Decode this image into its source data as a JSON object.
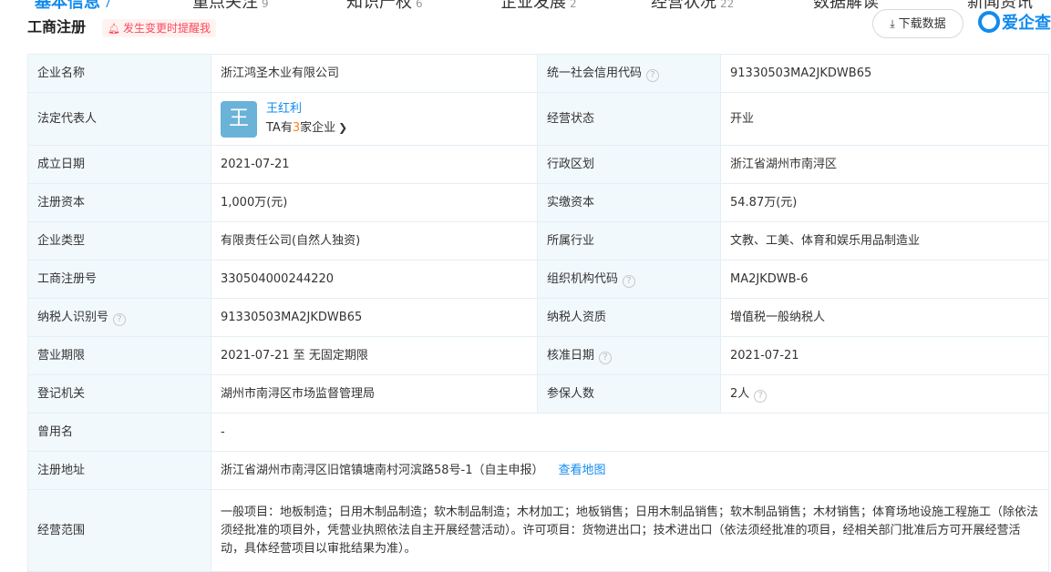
{
  "tabs": [
    {
      "label": "基本信息",
      "count": "7",
      "active": true
    },
    {
      "label": "重点关注",
      "count": "9"
    },
    {
      "label": "知识产权",
      "count": "6"
    },
    {
      "label": "企业发展",
      "count": "2"
    },
    {
      "label": "经营状况",
      "count": "22"
    },
    {
      "label": "数据解读",
      "count": ""
    },
    {
      "label": "新闻资讯",
      "count": ""
    }
  ],
  "header": {
    "title": "工商注册",
    "remind": "发生变更时提醒我",
    "download": "下载数据",
    "brand": "爱企查"
  },
  "rows": {
    "r1": {
      "l1": "企业名称",
      "v1": "浙江鸿圣木业有限公司",
      "l2": "统一社会信用代码",
      "v2": "91330503MA2JKDWB65"
    },
    "r2": {
      "l1": "法定代表人",
      "avatar": "王",
      "name": "王红利",
      "sub_pre": "TA有",
      "sub_count": "3",
      "sub_post": "家企业",
      "l2": "经营状态",
      "v2": "开业"
    },
    "r3": {
      "l1": "成立日期",
      "v1": "2021-07-21",
      "l2": "行政区划",
      "v2": "浙江省湖州市南浔区"
    },
    "r4": {
      "l1": "注册资本",
      "v1": "1,000万(元)",
      "l2": "实缴资本",
      "v2": "54.87万(元)"
    },
    "r5": {
      "l1": "企业类型",
      "v1": "有限责任公司(自然人独资)",
      "l2": "所属行业",
      "v2": "文教、工美、体育和娱乐用品制造业"
    },
    "r6": {
      "l1": "工商注册号",
      "v1": "330504000244220",
      "l2": "组织机构代码",
      "v2": "MA2JKDWB-6"
    },
    "r7": {
      "l1": "纳税人识别号",
      "v1": "91330503MA2JKDWB65",
      "l2": "纳税人资质",
      "v2": "增值税一般纳税人"
    },
    "r8": {
      "l1": "营业期限",
      "v1": "2021-07-21 至 无固定期限",
      "l2": "核准日期",
      "v2": "2021-07-21"
    },
    "r9": {
      "l1": "登记机关",
      "v1": "湖州市南浔区市场监督管理局",
      "l2": "参保人数",
      "v2": "2人"
    },
    "r10": {
      "l1": "曾用名",
      "v1": "-"
    },
    "r11": {
      "l1": "注册地址",
      "v1": "浙江省湖州市南浔区旧馆镇塘南村河滨路58号-1（自主申报）",
      "link": "查看地图"
    },
    "r12": {
      "l1": "经营范围",
      "v1": "一般项目：地板制造；日用木制品制造；软木制品制造；木材加工；地板销售；日用木制品销售；软木制品销售；木材销售；体育场地设施工程施工（除依法须经批准的项目外，凭营业执照依法自主开展经营活动）。许可项目：货物进出口；技术进出口（依法须经批准的项目，经相关部门批准后方可开展经营活动，具体经营项目以审批结果为准）。"
    }
  },
  "icons": {
    "help": "question-icon",
    "bell": "bell-icon",
    "download": "download-icon",
    "chevron": "chevron-right-icon"
  },
  "colors": {
    "accent": "#128bed",
    "label_bg": "#f2f9fc",
    "border": "#e4eef6",
    "alert": "#fd485e",
    "highlight": "#ff7f17"
  }
}
